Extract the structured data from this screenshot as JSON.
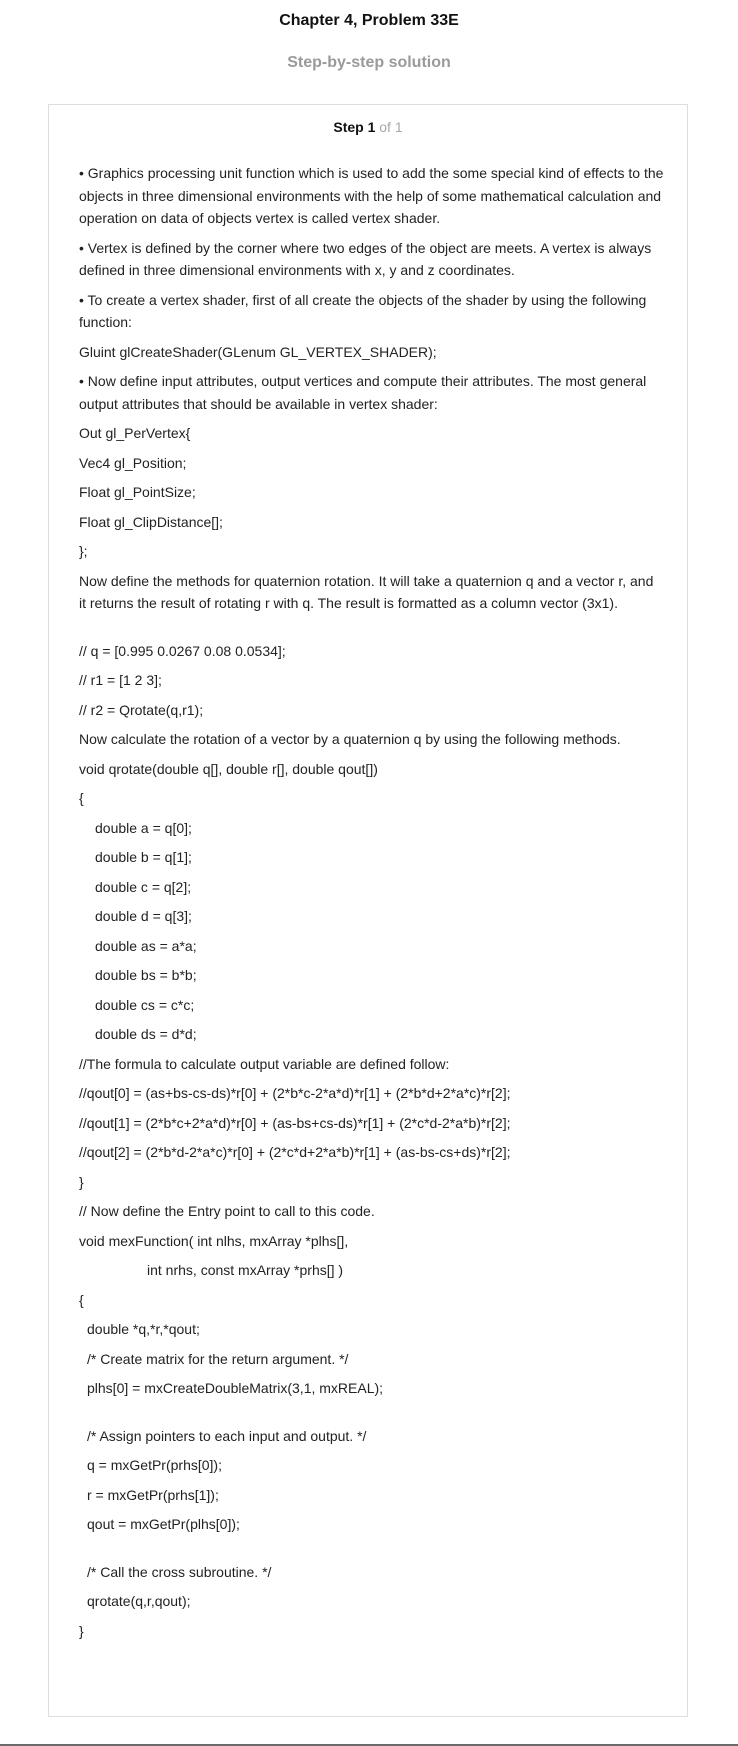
{
  "header": {
    "title": "Chapter 4, Problem 33E",
    "subtitle": "Step-by-step solution"
  },
  "step": {
    "label": "Step 1",
    "of": " of 1"
  },
  "content": {
    "p1": "• Graphics processing unit function which is used to add the some special kind of effects to the objects in three dimensional environments with the help of some mathematical calculation and operation on data of objects vertex is called vertex shader.",
    "p2": "• Vertex is defined by the corner where two edges of the object are meets. A vertex is always defined in three dimensional environments with x, y and z coordinates.",
    "p3": "• To create a vertex shader, first of all create the objects of the shader by using the following function:",
    "code1": "Gluint glCreateShader(GLenum GL_VERTEX_SHADER);",
    "p4": "• Now define input attributes, output vertices and compute their attributes. The most general output attributes that should be available in vertex shader:",
    "perVertex": [
      "Out gl_PerVertex{",
      "Vec4 gl_Position;",
      "Float gl_PointSize;",
      "Float gl_ClipDistance[];",
      "};"
    ],
    "p5": "Now define the methods for quaternion rotation. It will take a quaternion q and a vector r, and it returns the result of rotating r with q. The result is formatted as a column vector (3x1).",
    "comments": [
      "// q = [0.995 0.0267 0.08 0.0534];",
      "// r1 = [1 2 3];",
      "// r2 = Qrotate(q,r1);"
    ],
    "p6": "Now calculate the rotation of a vector by a quaternion q by using the following methods.",
    "qrotateSig": "void qrotate(double q[], double r[], double qout[])",
    "braceOpen": "{",
    "qrotateBody": [
      "double a = q[0];",
      "double b = q[1];",
      "double c = q[2];",
      "double d = q[3];",
      "double as = a*a;",
      "double bs = b*b;",
      "double cs = c*c;",
      "double ds = d*d;"
    ],
    "formulaComment": "//The formula to calculate output variable are defined follow:",
    "formulas": [
      "//qout[0] = (as+bs-cs-ds)*r[0] + (2*b*c-2*a*d)*r[1] + (2*b*d+2*a*c)*r[2];",
      "//qout[1] = (2*b*c+2*a*d)*r[0] + (as-bs+cs-ds)*r[1] + (2*c*d-2*a*b)*r[2];",
      "//qout[2] = (2*b*d-2*a*c)*r[0] + (2*c*d+2*a*b)*r[1] + (as-bs-cs+ds)*r[2];"
    ],
    "braceClose": "}",
    "entryComment": "// Now define the Entry point to call to this code.",
    "mexSig1": "void mexFunction( int nlhs, mxArray *plhs[],",
    "mexSig2": "int nrhs, const mxArray *prhs[] )",
    "mexBody1": [
      "double *q,*r,*qout;",
      "/* Create matrix for the return argument. */",
      "plhs[0] = mxCreateDoubleMatrix(3,1, mxREAL);"
    ],
    "mexBody2": [
      "/* Assign pointers to each input and output. */",
      "q = mxGetPr(prhs[0]);",
      "r = mxGetPr(prhs[1]);",
      "qout = mxGetPr(plhs[0]);"
    ],
    "mexBody3": [
      "/* Call the cross subroutine. */",
      "qrotate(q,r,qout);"
    ]
  }
}
